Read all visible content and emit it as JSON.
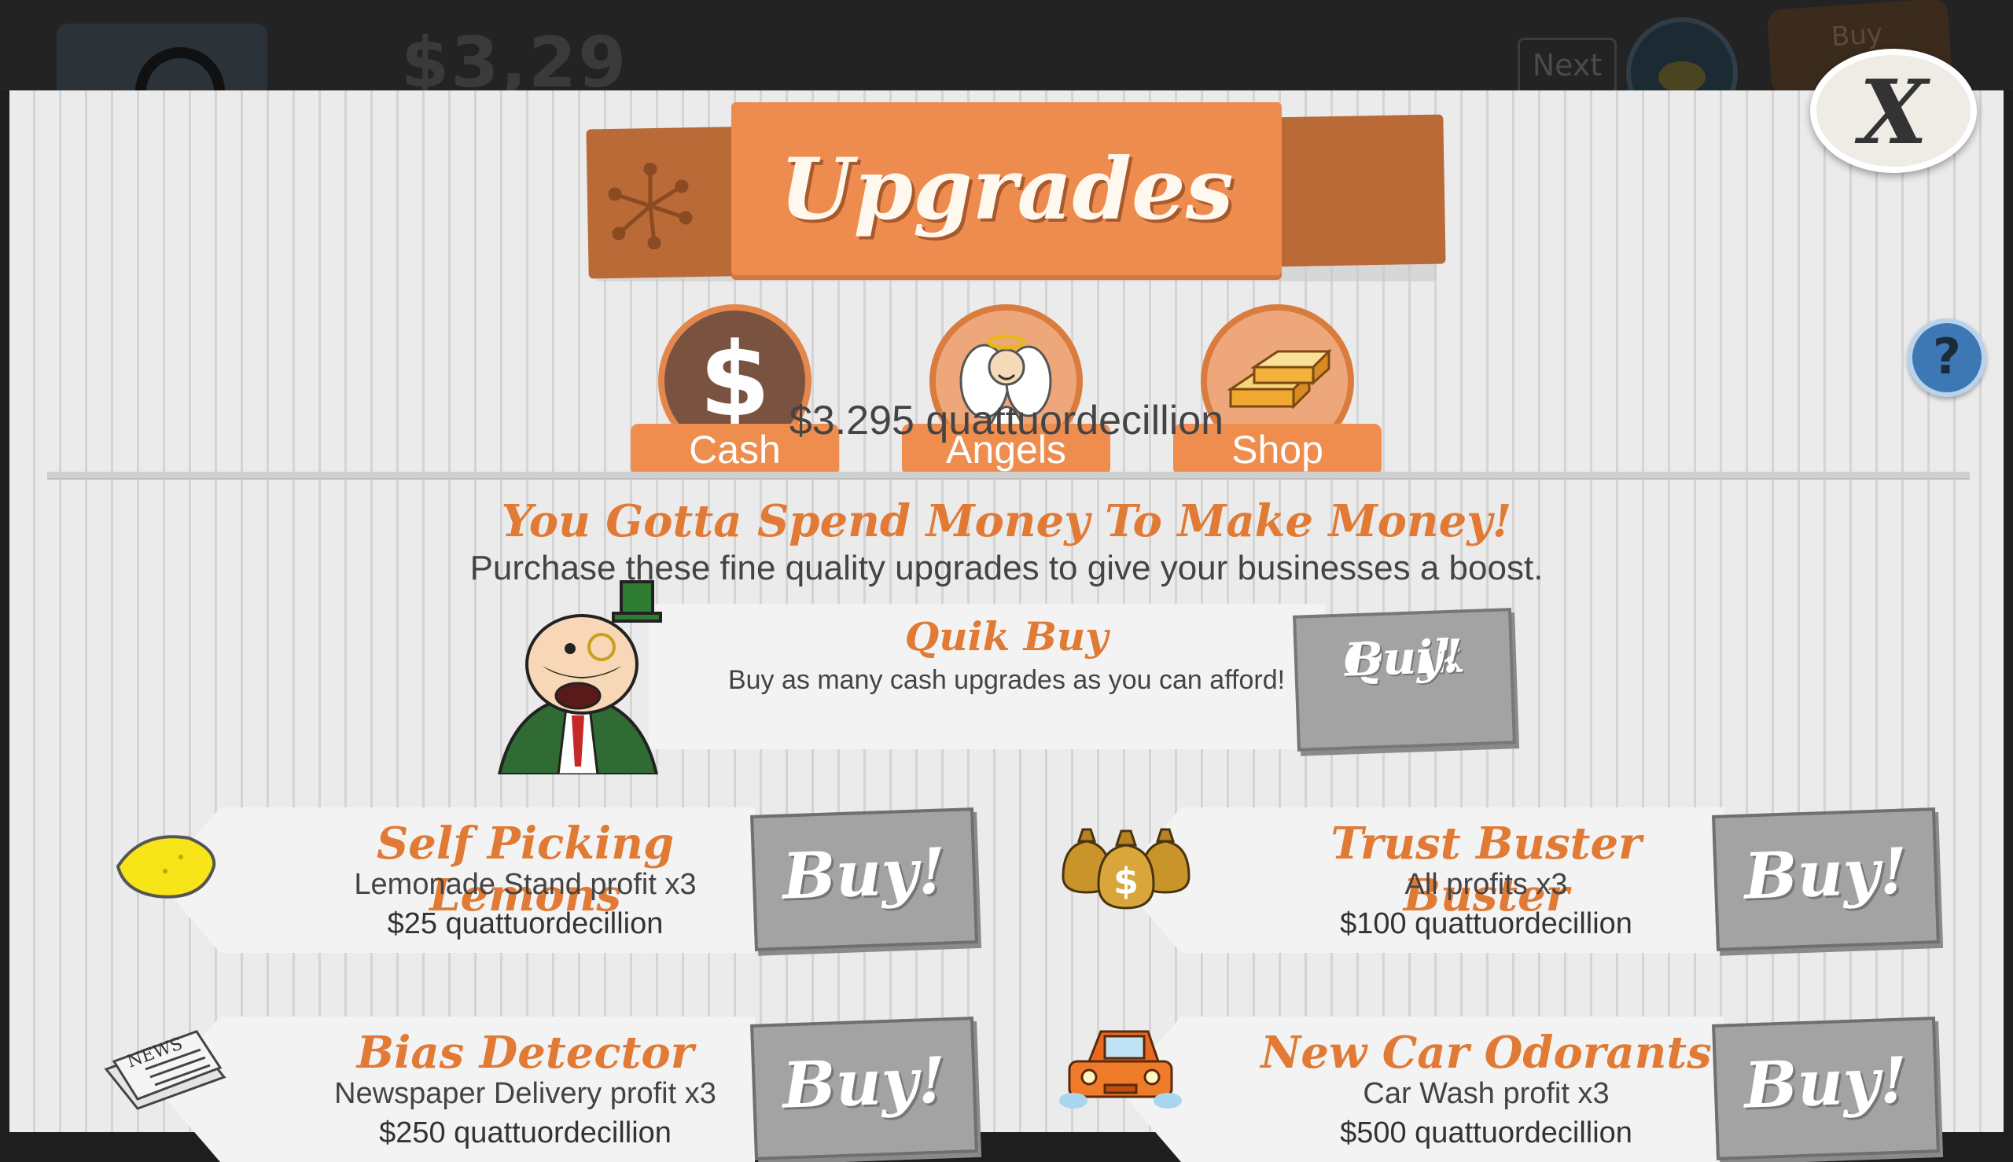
{
  "background_bar": {
    "money_text": "$3,29",
    "next_label": "Next",
    "buy_label": "Buy"
  },
  "modal": {
    "title": "Upgrades",
    "close_label": "X",
    "help_label": "?"
  },
  "tabs": [
    {
      "label": "Cash",
      "icon": "dollar-icon",
      "symbol": "$",
      "active": true
    },
    {
      "label": "Angels",
      "icon": "angel-icon",
      "active": false
    },
    {
      "label": "Shop",
      "icon": "gold-bars-icon",
      "active": false
    }
  ],
  "balance": "$3.295 quattuordecillion",
  "headline": "You Gotta Spend Money To Make Money!",
  "subline": "Purchase these fine quality upgrades to give your businesses a boost.",
  "quik_buy": {
    "title": "Quik Buy",
    "description": "Buy as many cash upgrades as you can afford!",
    "button_line1": "Quik",
    "button_line2": "Buy!"
  },
  "upgrades": [
    {
      "title": "Self Picking Lemons",
      "description": "Lemonade Stand profit x3",
      "cost": "$25 quattuordecillion",
      "icon": "lemon-icon",
      "button": "Buy!"
    },
    {
      "title": "Trust Buster Buster",
      "description": "All profits x3",
      "cost": "$100 quattuordecillion",
      "icon": "money-bags-icon",
      "button": "Buy!"
    },
    {
      "title": "Bias Detector",
      "description": "Newspaper Delivery profit x3",
      "cost": "$250 quattuordecillion",
      "icon": "newspaper-icon",
      "button": "Buy!"
    },
    {
      "title": "New Car Odorants",
      "description": "Car Wash profit x3",
      "cost": "$500 quattuordecillion",
      "icon": "car-icon",
      "button": "Buy!"
    }
  ],
  "colors": {
    "accent_orange": "#ef8d4e",
    "title_orange": "#e07a35",
    "button_gray": "#a3a3a3",
    "help_blue": "#3d77b4"
  }
}
